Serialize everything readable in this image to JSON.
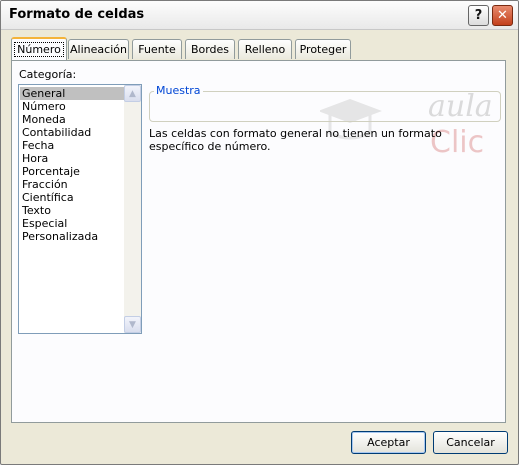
{
  "window": {
    "title": "Formato de celdas"
  },
  "titlebar": {
    "help_label": "?",
    "close_label": "✕"
  },
  "tabs": [
    {
      "label": "Número",
      "active": true
    },
    {
      "label": "Alineación"
    },
    {
      "label": "Fuente"
    },
    {
      "label": "Bordes"
    },
    {
      "label": "Relleno"
    },
    {
      "label": "Proteger"
    }
  ],
  "categoria": {
    "label": "Categoría:",
    "items": [
      "General",
      "Número",
      "Moneda",
      "Contabilidad",
      "Fecha",
      "Hora",
      "Porcentaje",
      "Fracción",
      "Científica",
      "Texto",
      "Especial",
      "Personalizada"
    ],
    "selected": "General"
  },
  "muestra": {
    "legend": "Muestra",
    "value": ""
  },
  "description": "Las celdas con formato general no tienen un formato específico de número.",
  "watermark": {
    "line1": "aula",
    "line2": "Clic"
  },
  "buttons": {
    "ok": "Aceptar",
    "cancel": "Cancelar"
  },
  "colors": {
    "window_bg": "#ece9d8",
    "panel_bg": "#fcfcfe",
    "active_tab_accent": "#f4b33a",
    "selection": "#c0c0c0",
    "legend_text": "#0046d5"
  }
}
